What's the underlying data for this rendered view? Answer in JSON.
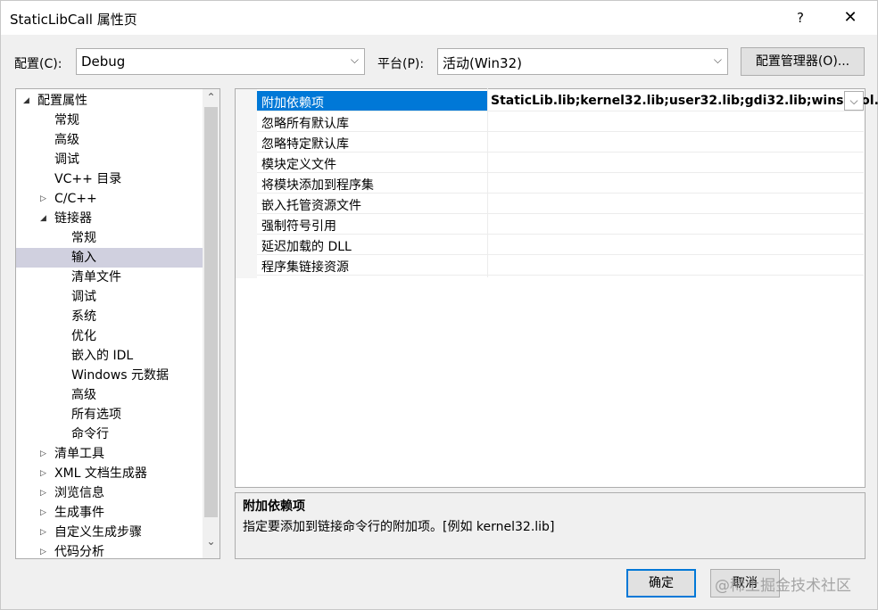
{
  "window": {
    "title": "StaticLibCall 属性页",
    "help_label": "?",
    "close_label": "✕"
  },
  "toolbar": {
    "config_label": "配置(C):",
    "config_value": "Debug",
    "platform_label": "平台(P):",
    "platform_value": "活动(Win32)",
    "config_manager_label": "配置管理器(O)...",
    "dropdown_glyph": "⌵"
  },
  "tree": {
    "items": [
      {
        "label": "配置属性",
        "twisty": "◢"
      },
      {
        "label": "常规",
        "twisty": ""
      },
      {
        "label": "高级",
        "twisty": ""
      },
      {
        "label": "调试",
        "twisty": ""
      },
      {
        "label": "VC++ 目录",
        "twisty": ""
      },
      {
        "label": "C/C++",
        "twisty": "▷"
      },
      {
        "label": "链接器",
        "twisty": "◢"
      },
      {
        "label": "常规",
        "twisty": ""
      },
      {
        "label": "输入",
        "twisty": ""
      },
      {
        "label": "清单文件",
        "twisty": ""
      },
      {
        "label": "调试",
        "twisty": ""
      },
      {
        "label": "系统",
        "twisty": ""
      },
      {
        "label": "优化",
        "twisty": ""
      },
      {
        "label": "嵌入的 IDL",
        "twisty": ""
      },
      {
        "label": "Windows 元数据",
        "twisty": ""
      },
      {
        "label": "高级",
        "twisty": ""
      },
      {
        "label": "所有选项",
        "twisty": ""
      },
      {
        "label": "命令行",
        "twisty": ""
      },
      {
        "label": "清单工具",
        "twisty": "▷"
      },
      {
        "label": "XML 文档生成器",
        "twisty": "▷"
      },
      {
        "label": "浏览信息",
        "twisty": "▷"
      },
      {
        "label": "生成事件",
        "twisty": "▷"
      },
      {
        "label": "自定义生成步骤",
        "twisty": "▷"
      },
      {
        "label": "代码分析",
        "twisty": "▷"
      }
    ],
    "scroll_up": "⌃",
    "scroll_down": "⌄"
  },
  "properties": {
    "rows": [
      {
        "name": "附加依赖项",
        "value": "StaticLib.lib;kernel32.lib;user32.lib;gdi32.lib;winspool."
      },
      {
        "name": "忽略所有默认库",
        "value": ""
      },
      {
        "name": "忽略特定默认库",
        "value": ""
      },
      {
        "name": "模块定义文件",
        "value": ""
      },
      {
        "name": "将模块添加到程序集",
        "value": ""
      },
      {
        "name": "嵌入托管资源文件",
        "value": ""
      },
      {
        "name": "强制符号引用",
        "value": ""
      },
      {
        "name": "延迟加载的 DLL",
        "value": ""
      },
      {
        "name": "程序集链接资源",
        "value": ""
      }
    ],
    "value_dropdown_glyph": "⌵"
  },
  "description": {
    "title": "附加依赖项",
    "text": "指定要添加到链接命令行的附加项。[例如 kernel32.lib]"
  },
  "footer": {
    "ok_label": "确定",
    "cancel_label": "取消"
  },
  "watermark": "@稀土掘金技术社区"
}
